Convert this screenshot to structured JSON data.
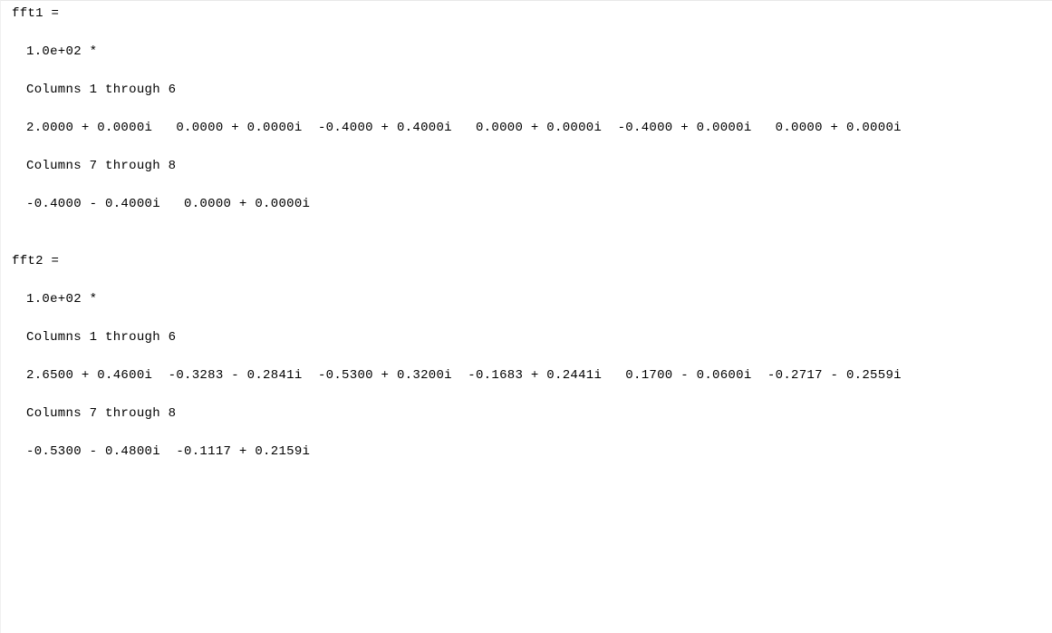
{
  "output": {
    "fft1": {
      "header": "fft1 =",
      "multiplier": "1.0e+02 *",
      "section1_label": "Columns 1 through 6",
      "section1_values": "2.0000 + 0.0000i   0.0000 + 0.0000i  -0.4000 + 0.4000i   0.0000 + 0.0000i  -0.4000 + 0.0000i   0.0000 + 0.0000i",
      "section2_label": "Columns 7 through 8",
      "section2_values": "-0.4000 - 0.4000i   0.0000 + 0.0000i"
    },
    "fft2": {
      "header": "fft2 =",
      "multiplier": "1.0e+02 *",
      "section1_label": "Columns 1 through 6",
      "section1_values": "2.6500 + 0.4600i  -0.3283 - 0.2841i  -0.5300 + 0.3200i  -0.1683 + 0.2441i   0.1700 - 0.0600i  -0.2717 - 0.2559i",
      "section2_label": "Columns 7 through 8",
      "section2_values": "-0.5300 - 0.4800i  -0.1117 + 0.2159i"
    }
  }
}
